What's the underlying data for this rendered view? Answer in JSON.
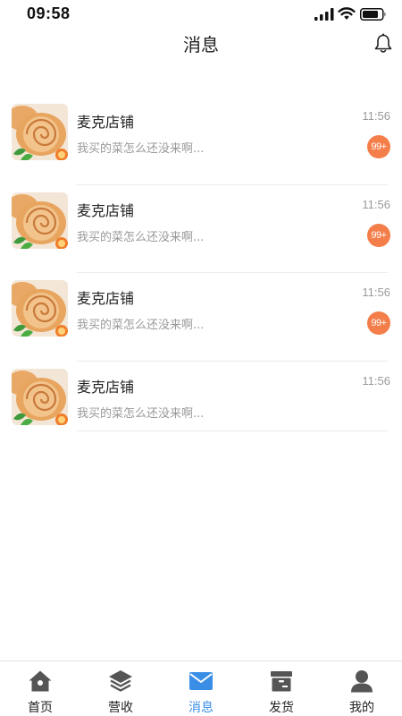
{
  "status_bar": {
    "time": "09:58"
  },
  "nav": {
    "title": "消息"
  },
  "messages": [
    {
      "name": "麦克店铺",
      "preview": "我买的菜怎么还没来啊...",
      "time": "11:56",
      "badge": "99+"
    },
    {
      "name": "麦克店铺",
      "preview": "我买的菜怎么还没来啊...",
      "time": "11:56",
      "badge": "99+"
    },
    {
      "name": "麦克店铺",
      "preview": "我买的菜怎么还没来啊...",
      "time": "11:56",
      "badge": "99+"
    },
    {
      "name": "麦克店铺",
      "preview": "我买的菜怎么还没来啊...",
      "time": "11:56",
      "badge": ""
    }
  ],
  "tabs": [
    {
      "label": "首页",
      "icon": "home-icon"
    },
    {
      "label": "营收",
      "icon": "layers-icon"
    },
    {
      "label": "消息",
      "icon": "mail-icon",
      "active": true
    },
    {
      "label": "发货",
      "icon": "box-icon"
    },
    {
      "label": "我的",
      "icon": "user-icon"
    }
  ],
  "colors": {
    "accent": "#3b8ee6",
    "badge": "#f47e4a",
    "tab_icon": "#555555"
  }
}
